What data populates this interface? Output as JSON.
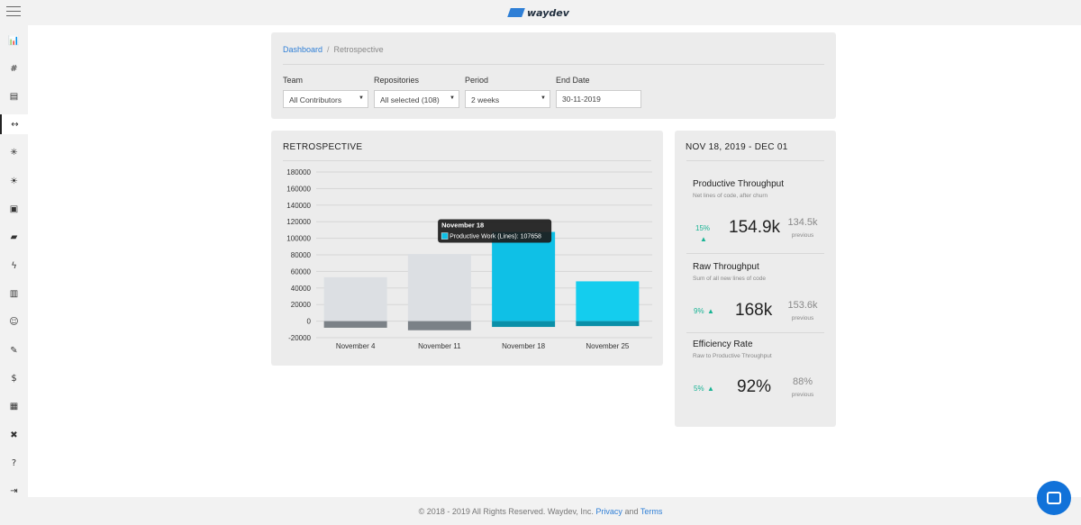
{
  "topbar": {
    "logo_text": "waydev"
  },
  "sidebar": {
    "icons": [
      {
        "name": "bar-chart-icon",
        "glyph": "📊"
      },
      {
        "name": "hashtag-icon",
        "glyph": "#"
      },
      {
        "name": "report-icon",
        "glyph": "▤"
      },
      {
        "name": "retrospective-icon",
        "glyph": "↔"
      },
      {
        "name": "bug-icon",
        "glyph": "✳"
      },
      {
        "name": "sun-icon",
        "glyph": "☀"
      },
      {
        "name": "calendar-icon",
        "glyph": "▣"
      },
      {
        "name": "chat-icon",
        "glyph": "▰"
      },
      {
        "name": "bolt-icon",
        "glyph": "ϟ"
      },
      {
        "name": "book-icon",
        "glyph": "▥"
      },
      {
        "name": "users-icon",
        "glyph": "☺"
      },
      {
        "name": "pencil-icon",
        "glyph": "✎"
      },
      {
        "name": "dollar-icon",
        "glyph": "$"
      },
      {
        "name": "document-icon",
        "glyph": "▦"
      },
      {
        "name": "tools-icon",
        "glyph": "✖"
      },
      {
        "name": "help-icon",
        "glyph": "?"
      },
      {
        "name": "logout-icon",
        "glyph": "⇥"
      }
    ]
  },
  "breadcrumb": {
    "home": "Dashboard",
    "separator": "/",
    "current": "Retrospective"
  },
  "filters": {
    "team": {
      "label": "Team",
      "value": "All Contributors"
    },
    "repositories": {
      "label": "Repositories",
      "value": "All selected (108)"
    },
    "period": {
      "label": "Period",
      "value": "2 weeks"
    },
    "end_date": {
      "label": "End Date",
      "value": "30-11-2019"
    }
  },
  "chart_panel": {
    "title": "Retrospective"
  },
  "chart_data": {
    "type": "bar",
    "categories": [
      "November 4",
      "November 11",
      "November 18",
      "November 25"
    ],
    "series": [
      {
        "name": "Productive Work (Lines)",
        "values": [
          53000,
          81000,
          107658,
          48000
        ]
      },
      {
        "values": [
          -8000,
          -11000,
          -7000,
          -6000
        ]
      }
    ],
    "ylim": [
      -20000,
      180000
    ],
    "yticks": [
      180000,
      160000,
      140000,
      120000,
      100000,
      80000,
      60000,
      40000,
      20000,
      0,
      -20000
    ],
    "highlighted_index": 2,
    "tooltip": {
      "title": "November 18",
      "text": "Productive Work (Lines): 107658"
    },
    "colors": {
      "default_pos": "#dcdfe3",
      "default_neg": "#7b8187",
      "active_pos": "#0fc0e6",
      "active_neg": "#0a8fa8",
      "light_active_pos": "#14cdee",
      "grid": "#d6d6d6"
    }
  },
  "stats": {
    "range_title": "NOV 18, 2019 - DEC 01",
    "items": [
      {
        "title": "Productive Throughput",
        "sub": "Net lines of code, after churn",
        "change": "15%",
        "value": "154.9k",
        "previous": "134.5k",
        "previous_label": "previous"
      },
      {
        "title": "Raw Throughput",
        "sub": "Sum of all new lines of code",
        "change": "9%",
        "value": "168k",
        "previous": "153.6k",
        "previous_label": "previous"
      },
      {
        "title": "Efficiency Rate",
        "sub": "Raw to Productive Throughput",
        "change": "5%",
        "value": "92%",
        "previous": "88%",
        "previous_label": "previous"
      }
    ],
    "accent_color": "#19b394"
  },
  "footer": {
    "text": "© 2018 - 2019 All Rights Reserved. Waydev, Inc.",
    "privacy": "Privacy",
    "and": "and",
    "terms": "Terms"
  }
}
